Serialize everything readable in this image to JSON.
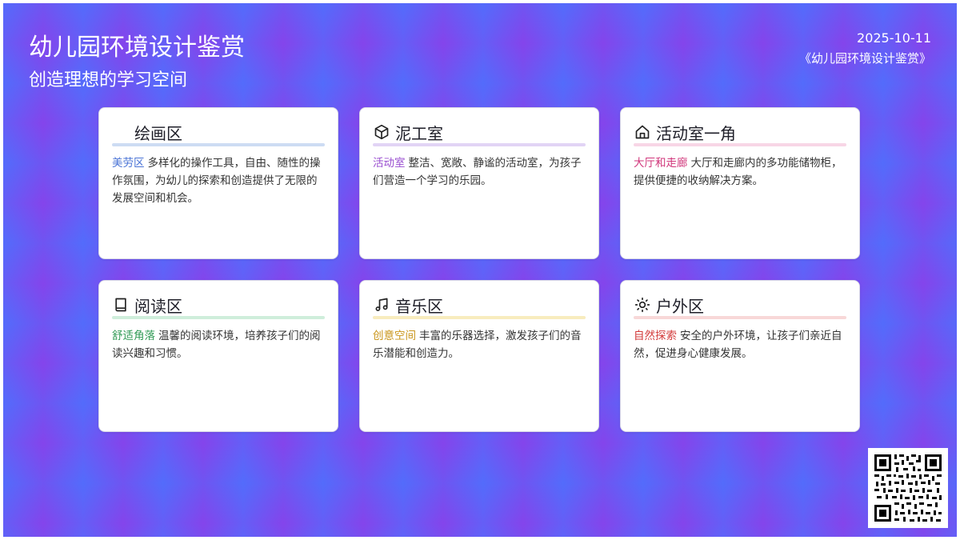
{
  "header": {
    "title": "幼儿园环境设计鉴赏",
    "subtitle": "创造理想的学习空间",
    "date": "2025-10-11",
    "source": "《幼儿园环境设计鉴赏》"
  },
  "cards": [
    {
      "title": "绘画区",
      "icon": "palette-icon",
      "tag": "美劳区",
      "tag_color": "#4b74d6",
      "underline_color": "#cddcf3",
      "text": "多样化的操作工具，自由、随性的操作氛围，为幼儿的探索和创造提供了无限的发展空间和机会。"
    },
    {
      "title": "泥工室",
      "icon": "cube-icon",
      "tag": "活动室",
      "tag_color": "#9a4fd0",
      "underline_color": "#e2d4f5",
      "text": "整洁、宽敞、静谧的活动室，为孩子们营造一个学习的乐园。"
    },
    {
      "title": "活动室一角",
      "icon": "home-icon",
      "tag": "大厅和走廊",
      "tag_color": "#d0357a",
      "underline_color": "#f8d6e6",
      "text": "大厅和走廊内的多功能储物柜，提供便捷的收纳解决方案。"
    },
    {
      "title": "阅读区",
      "icon": "book-icon",
      "tag": "舒适角落",
      "tag_color": "#2f9a54",
      "underline_color": "#cfeedb",
      "text": "温馨的阅读环境，培养孩子们的阅读兴趣和习惯。"
    },
    {
      "title": "音乐区",
      "icon": "music-icon",
      "tag": "创意空间",
      "tag_color": "#c99418",
      "underline_color": "#f8ecbe",
      "text": "丰富的乐器选择，激发孩子们的音乐潜能和创造力。"
    },
    {
      "title": "户外区",
      "icon": "sun-icon",
      "tag": "自然探索",
      "tag_color": "#d33a3a",
      "underline_color": "#f8d8d8",
      "text": "安全的户外环境，让孩子们亲近自然，促进身心健康发展。"
    }
  ],
  "qr": {
    "icon": "qr-code-icon"
  }
}
